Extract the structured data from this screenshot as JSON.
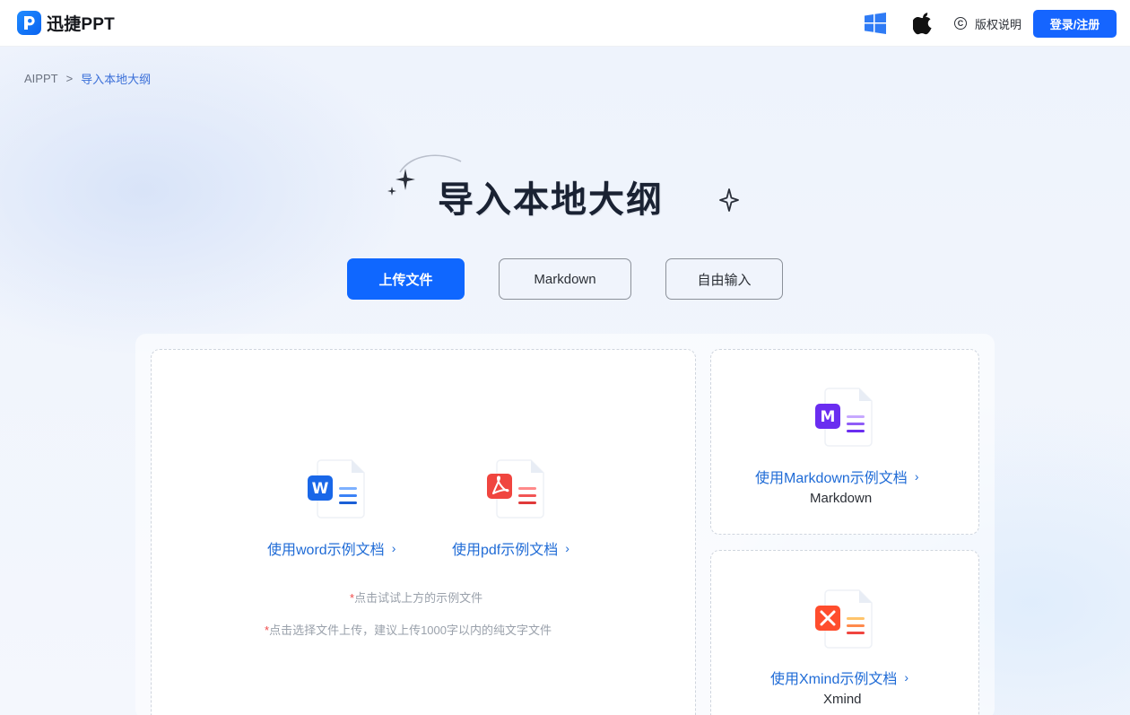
{
  "header": {
    "app_name": "迅捷PPT",
    "copyright_label": "版权说明",
    "login_label": "登录/注册"
  },
  "breadcrumb": {
    "root": "AIPPT",
    "separator": ">",
    "current": "导入本地大纲"
  },
  "page_title": "导入本地大纲",
  "tabs": [
    {
      "label": "上传文件",
      "active": true
    },
    {
      "label": "Markdown",
      "active": false
    },
    {
      "label": "自由输入",
      "active": false
    }
  ],
  "upload": {
    "word_link": "使用word示例文档",
    "pdf_link": "使用pdf示例文档",
    "hint_required_mark": "*",
    "hint_1": "点击试试上方的示例文件",
    "hint_2": "点击选择文件上传，建议上传1000字以内的纯文字文件"
  },
  "markdown_card": {
    "link": "使用Markdown示例文档",
    "label": "Markdown"
  },
  "xmind_card": {
    "link": "使用Xmind示例文档",
    "label": "Xmind"
  },
  "icons": {
    "chevron": "›",
    "word_badge": "W",
    "markdown_badge": "M",
    "copyright_symbol": "C"
  },
  "colors": {
    "primary": "#0f67ff",
    "link": "#1f6bd6",
    "word": "#1967e8",
    "pdf": "#f0453f",
    "markdown": "#6a2df0",
    "xmind": "#ff4d2d"
  }
}
